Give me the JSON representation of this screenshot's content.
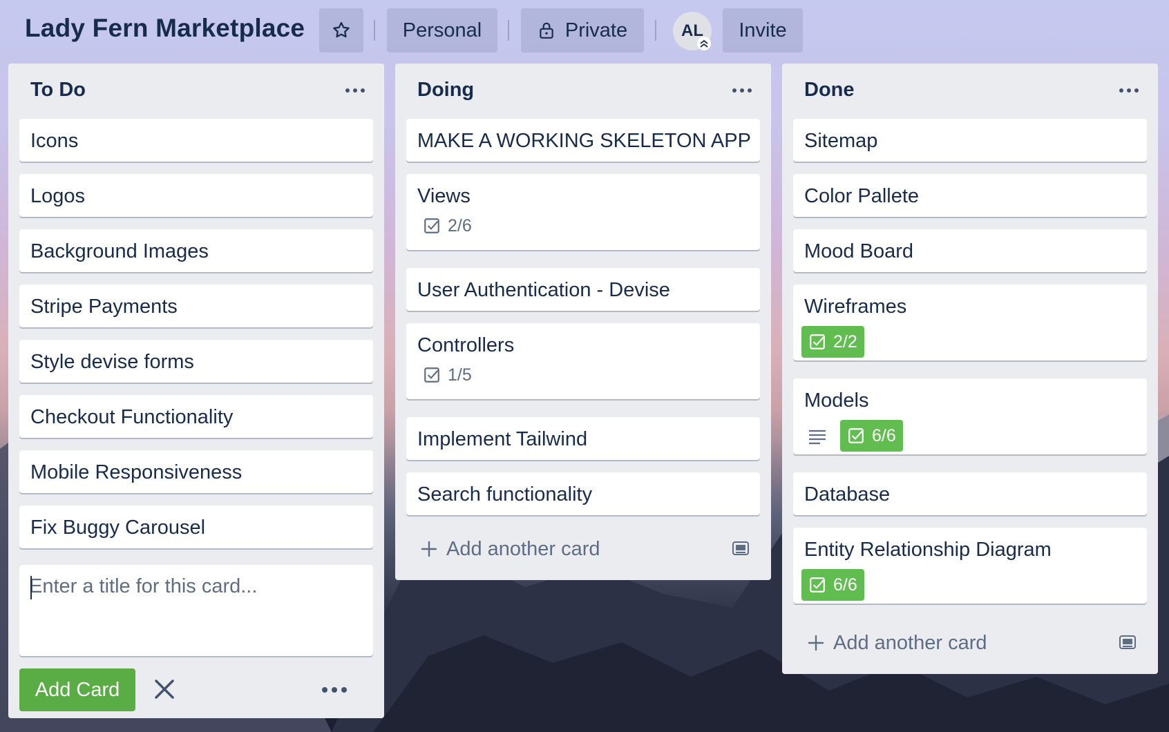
{
  "header": {
    "title": "Lady Fern Marketplace",
    "star_icon": "star-icon",
    "workspace_label": "Personal",
    "visibility_icon": "lock-icon",
    "visibility_label": "Private",
    "member_initials": "AL",
    "admin_badge_icon": "double-chevron-up-icon",
    "invite_label": "Invite"
  },
  "lists": [
    {
      "title": "To Do",
      "cards": [
        {
          "title": "Icons"
        },
        {
          "title": "Logos"
        },
        {
          "title": "Background Images"
        },
        {
          "title": "Stripe Payments"
        },
        {
          "title": "Style devise forms"
        },
        {
          "title": "Checkout Functionality"
        },
        {
          "title": "Mobile Responsiveness"
        },
        {
          "title": "Fix Buggy Carousel"
        }
      ],
      "composer": {
        "placeholder": "Enter a title for this card...",
        "value": "",
        "add_button_label": "Add Card"
      }
    },
    {
      "title": "Doing",
      "cards": [
        {
          "title": "MAKE A WORKING SKELETON APP"
        },
        {
          "title": "Views",
          "checklist": "2/6",
          "checklist_complete": false
        },
        {
          "title": "User Authentication - Devise"
        },
        {
          "title": "Controllers",
          "checklist": "1/5",
          "checklist_complete": false
        },
        {
          "title": "Implement Tailwind"
        },
        {
          "title": "Search functionality"
        }
      ],
      "add_card_label": "Add another card"
    },
    {
      "title": "Done",
      "cards": [
        {
          "title": "Sitemap"
        },
        {
          "title": "Color Pallete"
        },
        {
          "title": "Mood Board"
        },
        {
          "title": "Wireframes",
          "checklist": "2/2",
          "checklist_complete": true
        },
        {
          "title": "Models",
          "has_description": true,
          "checklist": "6/6",
          "checklist_complete": true
        },
        {
          "title": "Database"
        },
        {
          "title": "Entity Relationship Diagram",
          "checklist": "6/6",
          "checklist_complete": true
        }
      ],
      "add_card_label": "Add another card"
    }
  ],
  "colors": {
    "list_bg": "#ebecf0",
    "card_bg": "#ffffff",
    "text": "#172b4d",
    "muted": "#5e6c84",
    "checklist_complete": "#61bd4f",
    "add_button": "#5aac44"
  }
}
